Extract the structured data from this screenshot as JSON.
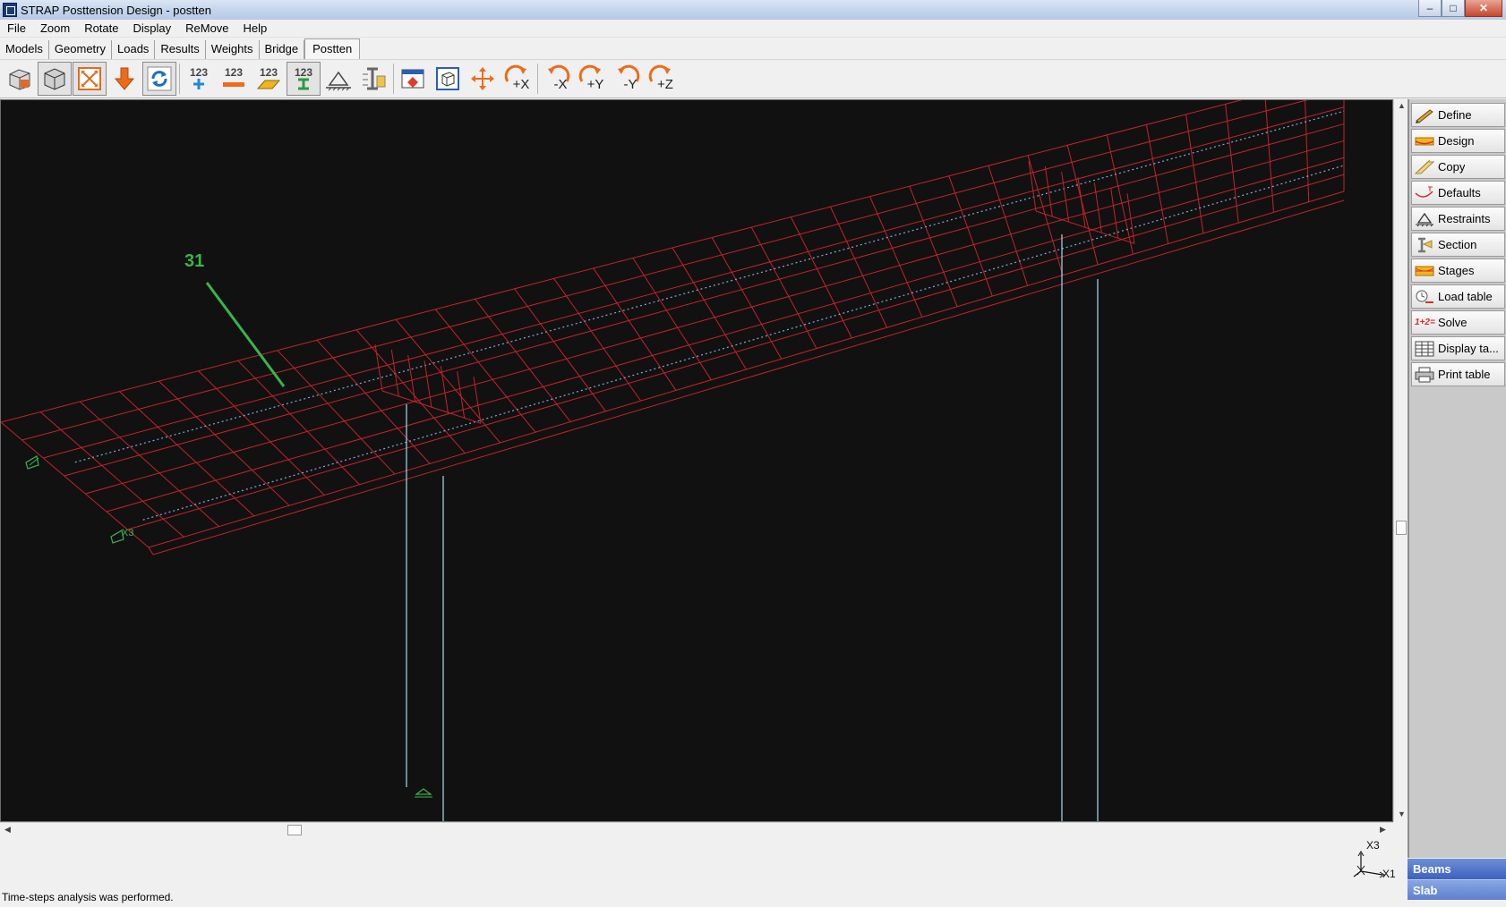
{
  "window": {
    "title": "STRAP Posttension Design - postten",
    "buttons": {
      "minimize": "–",
      "restore": "□",
      "close": "✕"
    }
  },
  "menu": [
    "File",
    "Zoom",
    "Rotate",
    "Display",
    "ReMove",
    "Help"
  ],
  "tabs": {
    "items": [
      "Models",
      "Geometry",
      "Loads",
      "Results",
      "Weights",
      "Bridge",
      "Postten"
    ],
    "active": "Postten"
  },
  "toolbar": {
    "num_label_1": "123",
    "num_label_2": "123",
    "num_label_3": "123",
    "num_label_4": "123",
    "rot_minus_x": "-X",
    "rot_plus_x": "+X",
    "rot_plus_y": "+Y",
    "rot_minus_y": "-Y",
    "rot_plus_z": "+Z"
  },
  "viewport": {
    "node_label": "31",
    "support_label": "X3",
    "colors": {
      "mesh": "#c4232c",
      "column": "#a6dcf0",
      "tendon": "#88a8d8",
      "label": "#39b54a",
      "background": "#111111"
    }
  },
  "side_panel": {
    "items": [
      {
        "label": "Define",
        "icon": "define-icon"
      },
      {
        "label": "Design",
        "icon": "design-icon"
      },
      {
        "label": "Copy",
        "icon": "copy-icon"
      },
      {
        "label": "Defaults",
        "icon": "defaults-icon"
      },
      {
        "label": "Restraints",
        "icon": "restraints-icon"
      },
      {
        "label": "Section",
        "icon": "section-icon"
      },
      {
        "label": "Stages",
        "icon": "stages-icon"
      },
      {
        "label": "Load table",
        "icon": "load-table-icon"
      },
      {
        "label": "Solve",
        "icon": "solve-icon"
      },
      {
        "label": "Display ta...",
        "icon": "display-table-icon"
      },
      {
        "label": "Print table",
        "icon": "print-table-icon"
      }
    ],
    "solve_icon_text": "1+2=",
    "modes": [
      "Beams",
      "Slab"
    ]
  },
  "axis_indicator": {
    "x3": "X3",
    "x1": "X1"
  },
  "status": "Time-steps analysis was performed."
}
